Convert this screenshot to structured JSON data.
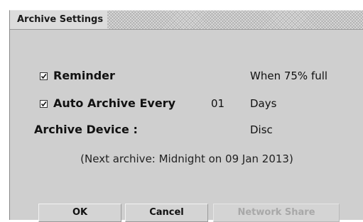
{
  "dialog": {
    "title": "Archive Settings"
  },
  "settings": {
    "reminder": {
      "label": "Reminder",
      "checked": true,
      "value": "When 75% full"
    },
    "auto_archive": {
      "label": "Auto Archive Every",
      "checked": true,
      "count": "01",
      "unit": "Days"
    },
    "archive_device": {
      "label": "Archive Device :",
      "value": "Disc"
    },
    "next_archive": "(Next archive: Midnight on 09 Jan 2013)"
  },
  "buttons": {
    "ok": "OK",
    "cancel": "Cancel",
    "network_share": "Network Share"
  },
  "colors": {
    "dialog_background": "#cfcfcf",
    "disabled_text": "#a8a8a8"
  }
}
